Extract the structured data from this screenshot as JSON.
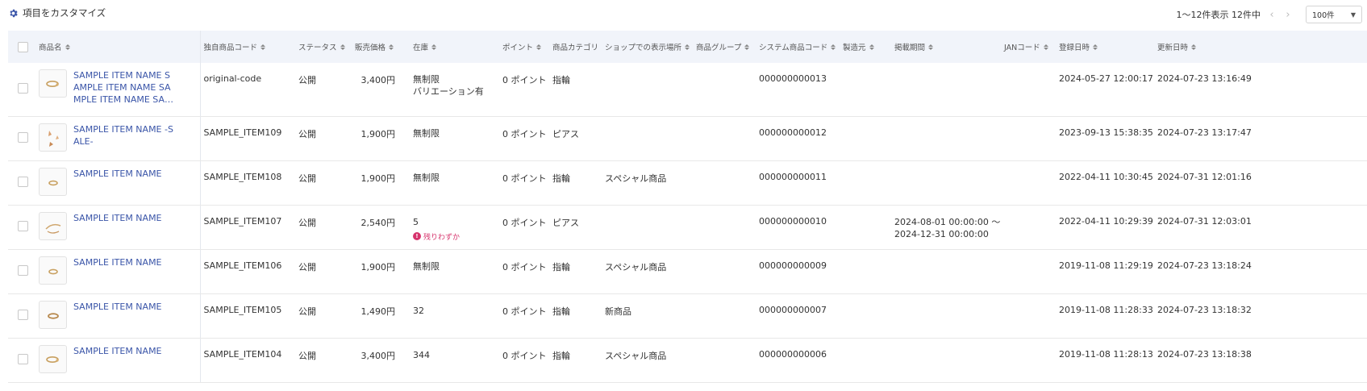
{
  "toolbar": {
    "customize_label": "項目をカスタマイズ",
    "icon": "gear-icon",
    "pagination_text": "1〜12件表示 12件中",
    "prev_icon": "chevron-left-icon",
    "next_icon": "chevron-right-icon",
    "per_page_value": "100件"
  },
  "columns": [
    {
      "key": "name",
      "label": "商品名"
    },
    {
      "key": "code",
      "label": "独自商品コード"
    },
    {
      "key": "status",
      "label": "ステータス"
    },
    {
      "key": "price",
      "label": "販売価格"
    },
    {
      "key": "stock",
      "label": "在庫"
    },
    {
      "key": "point",
      "label": "ポイント"
    },
    {
      "key": "category",
      "label": "商品カテゴリ"
    },
    {
      "key": "place",
      "label": "ショップでの表示場所"
    },
    {
      "key": "group",
      "label": "商品グループ"
    },
    {
      "key": "syscode",
      "label": "システム商品コード"
    },
    {
      "key": "maker",
      "label": "製造元"
    },
    {
      "key": "period",
      "label": "掲載期間"
    },
    {
      "key": "jan",
      "label": "JANコード"
    },
    {
      "key": "created",
      "label": "登録日時"
    },
    {
      "key": "updated",
      "label": "更新日時"
    }
  ],
  "rows": [
    {
      "name": "SAMPLE ITEM NAME SAMPLE ITEM NAME SAMPLE ITEM NAME SAMPLE ITEM NAME",
      "code": "original-code",
      "status": "公開",
      "price": "3,400円",
      "stock": "無制限",
      "stock_note": "バリエーション有",
      "stock_alert": "",
      "point": "0 ポイント",
      "category": "指輪",
      "place": "",
      "group": "",
      "syscode": "000000000013",
      "maker": "",
      "period_start": "",
      "period_end": "",
      "jan": "",
      "created": "2024-05-27 12:00:17",
      "updated": "2024-07-23 13:16:49"
    },
    {
      "name": "SAMPLE ITEM NAME -SALE-",
      "code": "SAMPLE_ITEM109",
      "status": "公開",
      "price": "1,900円",
      "stock": "無制限",
      "stock_note": "",
      "stock_alert": "",
      "point": "0 ポイント",
      "category": "ピアス",
      "place": "",
      "group": "",
      "syscode": "000000000012",
      "maker": "",
      "period_start": "",
      "period_end": "",
      "jan": "",
      "created": "2023-09-13 15:38:35",
      "updated": "2024-07-23 13:17:47"
    },
    {
      "name": "SAMPLE ITEM NAME",
      "code": "SAMPLE_ITEM108",
      "status": "公開",
      "price": "1,900円",
      "stock": "無制限",
      "stock_note": "",
      "stock_alert": "",
      "point": "0 ポイント",
      "category": "指輪",
      "place": "スペシャル商品",
      "group": "",
      "syscode": "000000000011",
      "maker": "",
      "period_start": "",
      "period_end": "",
      "jan": "",
      "created": "2022-04-11 10:30:45",
      "updated": "2024-07-31 12:01:16"
    },
    {
      "name": "SAMPLE ITEM NAME",
      "code": "SAMPLE_ITEM107",
      "status": "公開",
      "price": "2,540円",
      "stock": "5",
      "stock_note": "",
      "stock_alert": "残りわずか",
      "point": "0 ポイント",
      "category": "ピアス",
      "place": "",
      "group": "",
      "syscode": "000000000010",
      "maker": "",
      "period_start": "2024-08-01 00:00:00 〜",
      "period_end": "2024-12-31 00:00:00",
      "jan": "",
      "created": "2022-04-11 10:29:39",
      "updated": "2024-07-31 12:03:01"
    },
    {
      "name": "SAMPLE ITEM NAME",
      "code": "SAMPLE_ITEM106",
      "status": "公開",
      "price": "1,900円",
      "stock": "無制限",
      "stock_note": "",
      "stock_alert": "",
      "point": "0 ポイント",
      "category": "指輪",
      "place": "スペシャル商品",
      "group": "",
      "syscode": "000000000009",
      "maker": "",
      "period_start": "",
      "period_end": "",
      "jan": "",
      "created": "2019-11-08 11:29:19",
      "updated": "2024-07-23 13:18:24"
    },
    {
      "name": "SAMPLE ITEM NAME",
      "code": "SAMPLE_ITEM105",
      "status": "公開",
      "price": "1,490円",
      "stock": "32",
      "stock_note": "",
      "stock_alert": "",
      "point": "0 ポイント",
      "category": "指輪",
      "place": "新商品",
      "group": "",
      "syscode": "000000000007",
      "maker": "",
      "period_start": "",
      "period_end": "",
      "jan": "",
      "created": "2019-11-08 11:28:33",
      "updated": "2024-07-23 13:18:32"
    },
    {
      "name": "SAMPLE ITEM NAME",
      "code": "SAMPLE_ITEM104",
      "status": "公開",
      "price": "3,400円",
      "stock": "344",
      "stock_note": "",
      "stock_alert": "",
      "point": "0 ポイント",
      "category": "指輪",
      "place": "スペシャル商品",
      "group": "",
      "syscode": "000000000006",
      "maker": "",
      "period_start": "",
      "period_end": "",
      "jan": "",
      "created": "2019-11-08 11:28:13",
      "updated": "2024-07-23 13:18:38"
    }
  ],
  "colors": {
    "link": "#3a55a8",
    "header_bg": "#f1f4fa",
    "alert": "#d6336c"
  }
}
